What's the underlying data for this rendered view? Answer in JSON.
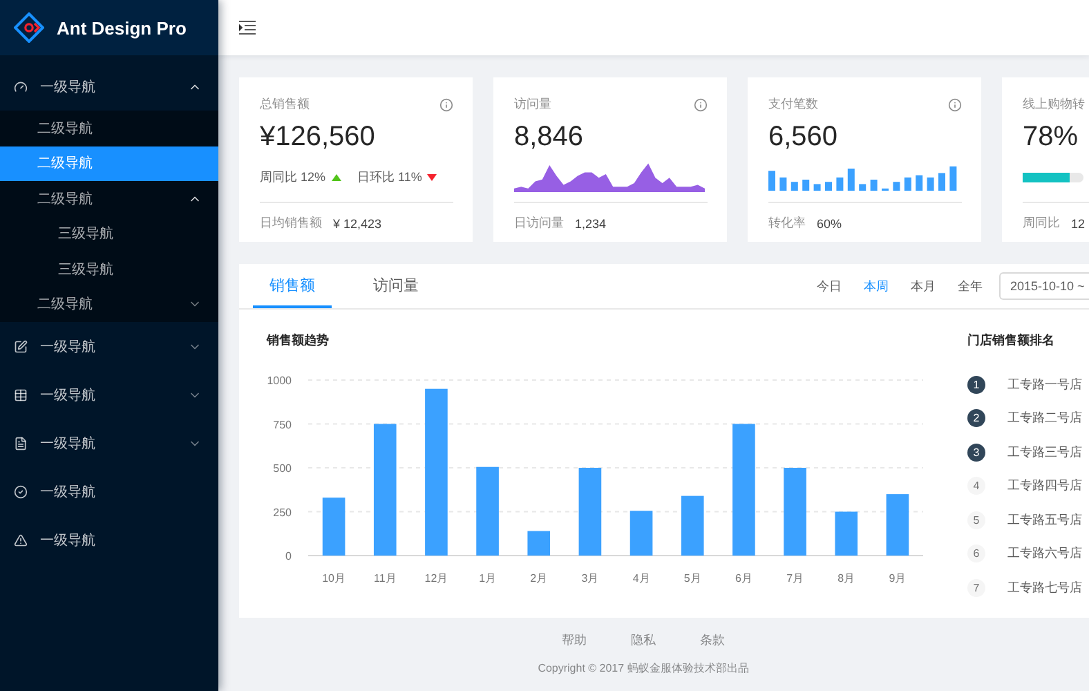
{
  "logo": {
    "title": "Ant Design Pro"
  },
  "sidebar": {
    "items": [
      {
        "label": "一级导航",
        "kind": "dashboard",
        "expanded": true,
        "selected": false,
        "children": [
          {
            "label": "二级导航",
            "selected": false
          },
          {
            "label": "二级导航",
            "selected": true
          },
          {
            "label": "二级导航",
            "selected": false,
            "expanded": true,
            "children": [
              {
                "label": "三级导航",
                "selected": false
              },
              {
                "label": "三级导航",
                "selected": false
              }
            ]
          },
          {
            "label": "二级导航",
            "selected": false,
            "expanded": false
          }
        ]
      },
      {
        "label": "一级导航",
        "kind": "form",
        "expanded": false,
        "selected": false
      },
      {
        "label": "一级导航",
        "kind": "table",
        "expanded": false,
        "selected": false
      },
      {
        "label": "一级导航",
        "kind": "profile",
        "expanded": false,
        "selected": false
      },
      {
        "label": "一级导航",
        "kind": "check",
        "selected": false
      },
      {
        "label": "一级导航",
        "kind": "warning",
        "selected": false
      }
    ]
  },
  "stat_cards": [
    {
      "kind": "trend",
      "title": "总销售额",
      "value": "¥126,560",
      "trends": [
        {
          "label": "周同比",
          "value": "12%",
          "kind": "up"
        },
        {
          "label": "日环比",
          "value": "11%",
          "kind": "down"
        }
      ],
      "footer_label": "日均销售额",
      "footer_value": "¥ 12,423"
    },
    {
      "kind": "area",
      "title": "访问量",
      "value": "8,846",
      "footer_label": "日访问量",
      "footer_value": "1,234"
    },
    {
      "kind": "bars",
      "title": "支付笔数",
      "value": "6,560",
      "footer_label": "转化率",
      "footer_value": "60%"
    },
    {
      "kind": "progress",
      "title": "线上购物转",
      "value": "78%",
      "level": 0.78,
      "footer_label": "周同比",
      "footer_value": "12"
    }
  ],
  "sales": {
    "tabs": [
      {
        "label": "销售额",
        "selected": true
      },
      {
        "label": "访问量",
        "selected": false
      }
    ],
    "ranges": [
      {
        "label": "今日",
        "selected": false
      },
      {
        "label": "本周",
        "selected": true
      },
      {
        "label": "本月",
        "selected": false
      },
      {
        "label": "全年",
        "selected": false
      }
    ],
    "date_range": {
      "value": "2015-10-10 ~"
    },
    "chart_title": "销售额趋势",
    "chart_data": {
      "type": "bar",
      "categories": [
        "10月",
        "11月",
        "12月",
        "1月",
        "2月",
        "3月",
        "4月",
        "5月",
        "6月",
        "7月",
        "8月",
        "9月"
      ],
      "values": [
        330,
        750,
        950,
        505,
        140,
        500,
        255,
        340,
        750,
        500,
        250,
        350
      ],
      "ylim": [
        0,
        1000
      ],
      "yticks": [
        0,
        250,
        500,
        750,
        1000
      ],
      "grid": true
    },
    "ranking_title": "门店销售额排名",
    "ranking": [
      {
        "rank": "1",
        "name": "工专路一号店",
        "top": true
      },
      {
        "rank": "2",
        "name": "工专路二号店",
        "top": true
      },
      {
        "rank": "3",
        "name": "工专路三号店",
        "top": true
      },
      {
        "rank": "4",
        "name": "工专路四号店",
        "top": false
      },
      {
        "rank": "5",
        "name": "工专路五号店",
        "top": false
      },
      {
        "rank": "6",
        "name": "工专路六号店",
        "top": false
      },
      {
        "rank": "7",
        "name": "工专路七号店",
        "top": false
      }
    ]
  },
  "footer": {
    "links": [
      "帮助",
      "隐私",
      "条款"
    ],
    "copyright": "Copyright © 2017 蚂蚁金服体验技术部出品"
  }
}
